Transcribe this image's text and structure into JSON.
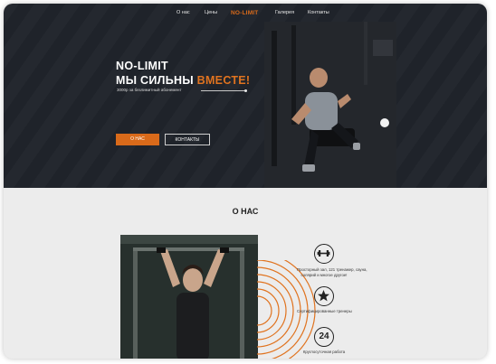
{
  "nav": {
    "items": [
      "О нас",
      "Цены",
      "NO-LIMIT",
      "Галерея",
      "Контакты"
    ]
  },
  "hero": {
    "title_line1": "NO-LIMIT",
    "title_line2_prefix": "МЫ СИЛЬНЫ ",
    "title_line2_accent": "ВМЕСТЕ!",
    "subtitle": "3000р за безлимитный абонемент",
    "button_about": "О НАС",
    "button_contacts": "КОНТАКТЫ"
  },
  "about": {
    "title": "О НАС",
    "features": [
      {
        "icon": "dumbbell-icon",
        "text_line1": "Просторный зал, 121 тренажер, сауна,",
        "text_line2": "солярий и многое другое!"
      },
      {
        "icon": "star-icon",
        "text_line1": "Сертифицированные тренеры",
        "text_line2": ""
      },
      {
        "icon": "clock-24-icon",
        "icon_text": "24",
        "text_line1": "Круглосуточная работа",
        "text_line2": ""
      }
    ]
  },
  "colors": {
    "accent": "#d96a1a",
    "hero_bg": "#1f232a",
    "section_bg": "#ececec"
  }
}
